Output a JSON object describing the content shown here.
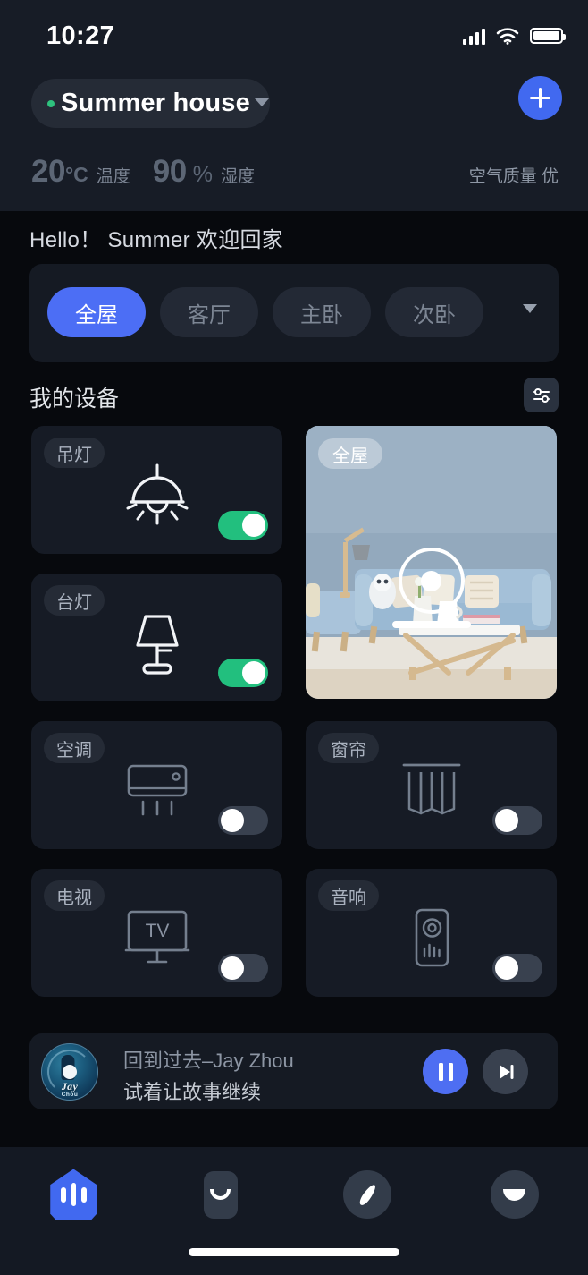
{
  "status_bar": {
    "time": "10:27",
    "signal_icon": "cellular-signal-icon",
    "wifi_icon": "wifi-icon",
    "battery_icon": "battery-full-icon"
  },
  "header": {
    "house_name": "Summer house",
    "house_status_dot_color": "#2ec27e",
    "dropdown_icon": "chevron-down-icon",
    "add_button_icon": "plus-icon",
    "environment": {
      "temperature_value": "20",
      "temperature_unit": "°C",
      "temperature_label": "温度",
      "humidity_value": "90",
      "humidity_unit": "%",
      "humidity_label": "湿度",
      "air_quality": "空气质量 优"
    }
  },
  "greeting": "Hello！ Summer 欢迎回家",
  "rooms": {
    "tabs": [
      {
        "label": "全屋",
        "active": true
      },
      {
        "label": "客厅",
        "active": false
      },
      {
        "label": "主卧",
        "active": false
      },
      {
        "label": "次卧",
        "active": false
      }
    ],
    "expand_icon": "chevron-down-icon"
  },
  "devices_section": {
    "title": "我的设备",
    "filter_icon": "sliders-settings-icon"
  },
  "devices": [
    {
      "label": "吊灯",
      "icon": "pendant-lamp-icon",
      "on": true
    },
    {
      "label": "台灯",
      "icon": "desk-lamp-icon",
      "on": true
    },
    {
      "label": "空调",
      "icon": "air-conditioner-icon",
      "on": false
    },
    {
      "label": "窗帘",
      "icon": "curtain-icon",
      "on": false
    },
    {
      "label": "电视",
      "icon": "tv-icon",
      "on": false,
      "screen_text": "TV"
    },
    {
      "label": "音响",
      "icon": "speaker-icon",
      "on": false
    }
  ],
  "room_photo_card": {
    "label": "全屋",
    "power_icon": "power-ring-icon",
    "scene_description": "living-room-photo"
  },
  "player": {
    "album_art_title": "Jay",
    "album_art_subtitle": "Chou",
    "track_title": "回到过去–Jay Zhou",
    "track_lyric": "试着让故事继续",
    "play_icon": "pause-icon",
    "next_icon": "next-track-icon"
  },
  "bottom_nav": [
    {
      "name": "home",
      "icon": "home-house-icon",
      "active": true
    },
    {
      "name": "scenes",
      "icon": "smile-square-icon",
      "active": false
    },
    {
      "name": "discover",
      "icon": "compass-needle-icon",
      "active": false
    },
    {
      "name": "profile",
      "icon": "dome-circle-icon",
      "active": false
    }
  ],
  "colors": {
    "accent_blue": "#4169f0",
    "pill_blue": "#4c6ef5",
    "toggle_on_green": "#22bf7e",
    "toggle_off_gray": "#39414f",
    "header_bg": "#171c26",
    "page_bg": "#07090d",
    "card_bg": "#161b25",
    "navbar_bg": "#141923"
  },
  "home_indicator": "home-indicator-bar"
}
